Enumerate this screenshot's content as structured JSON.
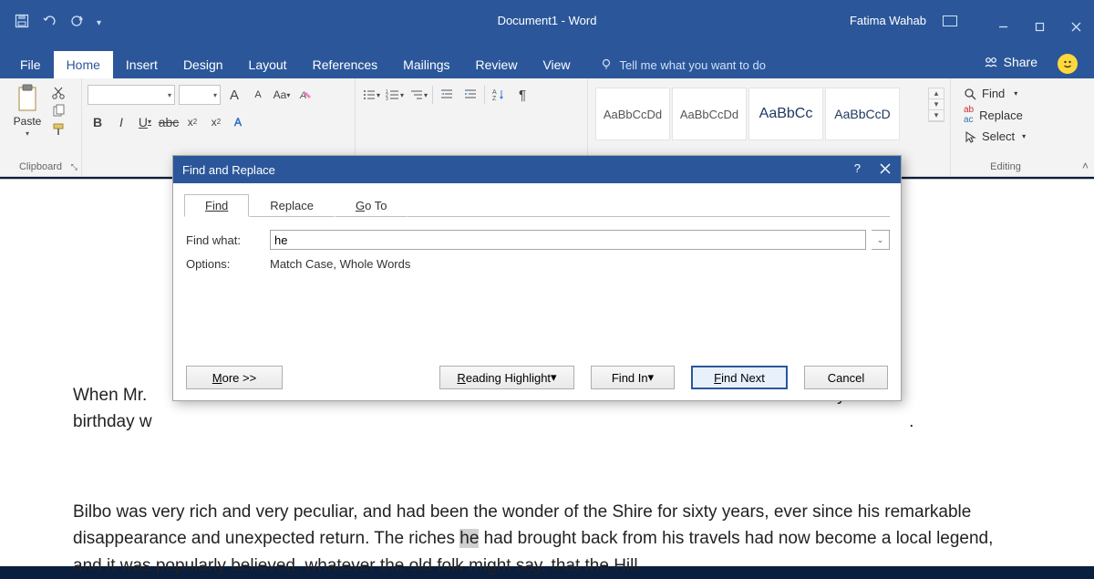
{
  "titlebar": {
    "document_title": "Document1",
    "separator": " - ",
    "app_name": "Word",
    "user_name": "Fatima Wahab"
  },
  "tabs": {
    "file": "File",
    "home": "Home",
    "insert": "Insert",
    "design": "Design",
    "layout": "Layout",
    "references": "References",
    "mailings": "Mailings",
    "review": "Review",
    "view": "View",
    "tellme_placeholder": "Tell me what you want to do",
    "share": "Share"
  },
  "ribbon": {
    "clipboard": {
      "paste": "Paste",
      "label": "Clipboard"
    },
    "font": {
      "increase": "A",
      "decrease": "A",
      "caseBtn": "Aa",
      "bold": "B",
      "italic": "I",
      "underline": "U"
    },
    "styles": {
      "s1": "AaBbCcDd",
      "s2": "AaBbCcDd",
      "s3": "AaBbCc",
      "s4": "AaBbCcD"
    },
    "editing": {
      "find": "Find",
      "replace": "Replace",
      "select": "Select",
      "label": "Editing"
    }
  },
  "dialog": {
    "title": "Find and Replace",
    "tabs": {
      "find": "Find",
      "replace": "Replace",
      "goto_prefix": "G",
      "goto_rest": "o To"
    },
    "find_what_label": "Find what:",
    "find_what_value": "he",
    "options_label": "Options:",
    "options_value": "Match Case, Whole Words",
    "more_prefix": "M",
    "more_rest": "ore >>",
    "reading_prefix": "R",
    "reading_rest": "eading Highlight",
    "reading_arrow": " ▾",
    "find_in_label": "Find In",
    "find_in_arrow": " ▾",
    "find_next_prefix": "F",
    "find_next_rest": "ind Next",
    "cancel": "Cancel"
  },
  "document": {
    "p1a": "When Mr.",
    "p1b": "ty-first",
    "p2_line1": "birthday w",
    "p2_dot": ".",
    "p3_a": "Bilbo was very rich and very peculiar, and had been the wonder of the Shire for sixty years, ever since his remarkable disappearance and unexpected return. The riches ",
    "p3_hl": "he",
    "p3_b": " had brought back from his travels had now become a local legend, and it was popularly believed, whatever the old folk might say, that the Hill"
  }
}
